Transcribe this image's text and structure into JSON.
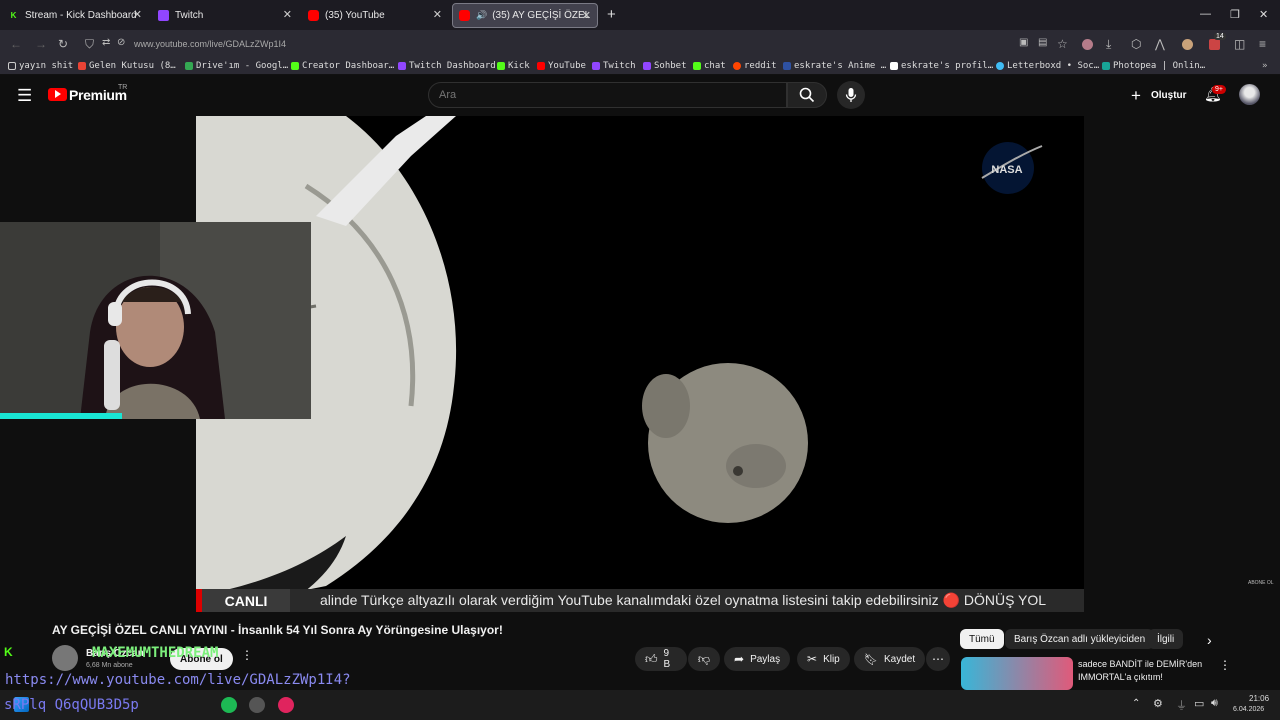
{
  "browser": {
    "tabs": [
      {
        "label": "Stream - Kick Dashboard"
      },
      {
        "label": "Twitch"
      },
      {
        "label": "(35) YouTube"
      },
      {
        "label": "(35) AY GEÇİŞİ ÖZEL"
      }
    ],
    "url": "www.youtube.com/live/GDALzZWp1I4",
    "bookmarks": [
      "yayın shit",
      "Gelen Kutusu (8…",
      "Drive'ım - Googl…",
      "Creator Dashboar…",
      "Twitch Dashboard",
      "Kick",
      "YouTube",
      "Twitch",
      "Sohbet",
      "chat",
      "reddit",
      "eskrate's Anime …",
      "eskrate's profil…",
      "Letterboxd • Soc…",
      "Photopea | Onlin…"
    ],
    "ext_badge": "14"
  },
  "youtube": {
    "logo": "Premium",
    "logo_sup": "TR",
    "search_placeholder": "Ara",
    "create_label": "Oluştur",
    "notif_count": "9+"
  },
  "player": {
    "watermark": "NASA",
    "live_label": "CANLI",
    "ticker": "alinde Türkçe altyazılı olarak verdiğim YouTube kanalımdaki özel oynatma listesini takip edebilirsiniz 🔴 DÖNÜŞ YOL",
    "corner_text": "ABONE OL"
  },
  "video": {
    "title": "AY GEÇİŞİ ÖZEL CANLI YAYINI - İnsanlık 54 Yıl Sonra Ay Yörüngesine Ulaşıyor!",
    "channel": "Barış Özcan",
    "subscribers": "6,68 Mn abone",
    "subscribe_label": "Abone ol",
    "likes": "9 B",
    "share_label": "Paylaş",
    "clip_label": "Klip",
    "save_label": "Kaydet"
  },
  "sidebar": {
    "chips": [
      "Tümü",
      "Barış Özcan adlı yükleyiciden",
      "İlgili"
    ],
    "rec_title": "sadece BANDİT ile DEMİR'den IMMORTAL'a çıkıtım!"
  },
  "stream_overlay": {
    "chat_name": "MAXEMUMTHEDREAM",
    "url_text": "https://www.youtube.com/live/GDALzZWp1I4?",
    "bottom_text": "sRPlq Q6qQUB3D5p"
  },
  "taskbar": {
    "time": "21:06",
    "date": "6.04.2026"
  },
  "colors": {
    "yt_red": "#ff0000",
    "kick_green": "#53fc18",
    "overlay_cyan": "#19e6d4"
  }
}
